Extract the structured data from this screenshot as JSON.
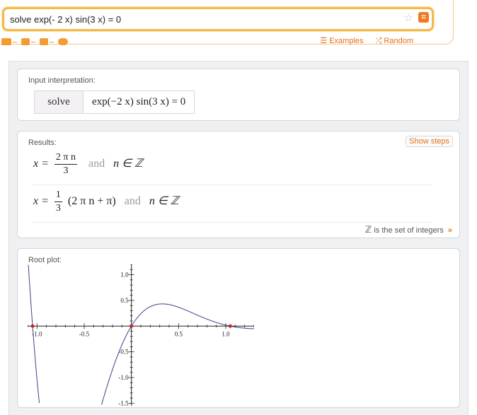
{
  "search": {
    "query": "solve exp(- 2 x) sin(3 x) = 0",
    "examples_label": "Examples",
    "random_label": "Random"
  },
  "pods": {
    "input": {
      "title": "Input interpretation:",
      "keyword": "solve",
      "expression": "exp(−2 x) sin(3 x) = 0"
    },
    "results": {
      "title": "Results:",
      "show_steps": "Show steps",
      "and_word": "and",
      "sol1": {
        "lhs": "x =",
        "num": "2 π n",
        "den": "3",
        "cond": "n ∈ ℤ"
      },
      "sol2": {
        "lhs": "x =",
        "num": "1",
        "den": "3",
        "rest": "(2 π n + π)",
        "cond": "n ∈ ℤ"
      },
      "note_symbol": "ℤ",
      "note_text": "is the set of integers",
      "note_more": "»"
    },
    "root_plot": {
      "title": "Root plot:"
    }
  },
  "colors": {
    "accent": "#e0701a",
    "curve": "#3f3f8f",
    "roots": "#cc2222"
  },
  "chart_data": {
    "type": "line",
    "function": "exp(-2x)·sin(3x)",
    "x_ticks": [
      "-1.0",
      "-0.5",
      "0.5",
      "1.0"
    ],
    "y_ticks": [
      "1.0",
      "0.5",
      "-0.5",
      "-1.0",
      "-1.5"
    ],
    "xlim": [
      -1.1,
      1.3
    ],
    "ylim": [
      -1.55,
      1.2
    ],
    "roots_x": [
      -1.0472,
      0,
      1.0472
    ]
  }
}
